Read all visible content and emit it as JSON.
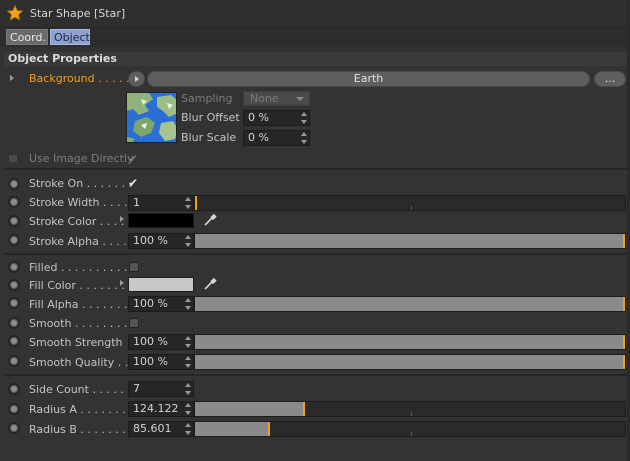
{
  "header": {
    "title": "Star Shape [Star]"
  },
  "tabs": [
    {
      "label": "Coord."
    },
    {
      "label": "Object"
    }
  ],
  "section": {
    "title": "Object Properties"
  },
  "background": {
    "label": "Background . . . . .",
    "shader_name": "Earth",
    "more_label": "...",
    "sampling_label": "Sampling",
    "sampling_value": "None",
    "blur_offset_label": "Blur Offset",
    "blur_offset_value": "0 %",
    "blur_scale_label": "Blur Scale",
    "blur_scale_value": "0 %",
    "use_image_label": "Use Image Directly"
  },
  "stroke": {
    "on_label": "Stroke On . . . . . . .",
    "width_label": "Stroke Width . . . .",
    "width_value": "1",
    "width_fraction": 0.0,
    "color_label": "Stroke Color . . . .",
    "color_hex": "#000000",
    "alpha_label": "Stroke Alpha . . . .",
    "alpha_value": "100 %",
    "alpha_fraction": 1.0
  },
  "fill": {
    "filled_label": "Filled . . . . . . . . . . .",
    "color_label": "Fill Color . . . . . . .",
    "color_hex": "#c8c8c8",
    "alpha_label": "Fill Alpha . . . . . . .",
    "alpha_value": "100 %",
    "alpha_fraction": 1.0
  },
  "smooth": {
    "smooth_label": "Smooth . . . . . . . . .",
    "strength_label": "Smooth Strength",
    "strength_value": "100 %",
    "strength_fraction": 1.0,
    "quality_label": "Smooth Quality . .",
    "quality_value": "100 %",
    "quality_fraction": 1.0
  },
  "geometry": {
    "side_count_label": "Side Count . . . . . .",
    "side_count_value": "7",
    "radius_a_label": "Radius A . . . . . . . .",
    "radius_a_value": "124.122",
    "radius_a_fraction": 0.25,
    "radius_b_label": "Radius B . . . . . . . .",
    "radius_b_value": "85.601",
    "radius_b_fraction": 0.17
  },
  "colors": {
    "accent": "#f0a020",
    "tab_active": "#8ea2cf"
  }
}
